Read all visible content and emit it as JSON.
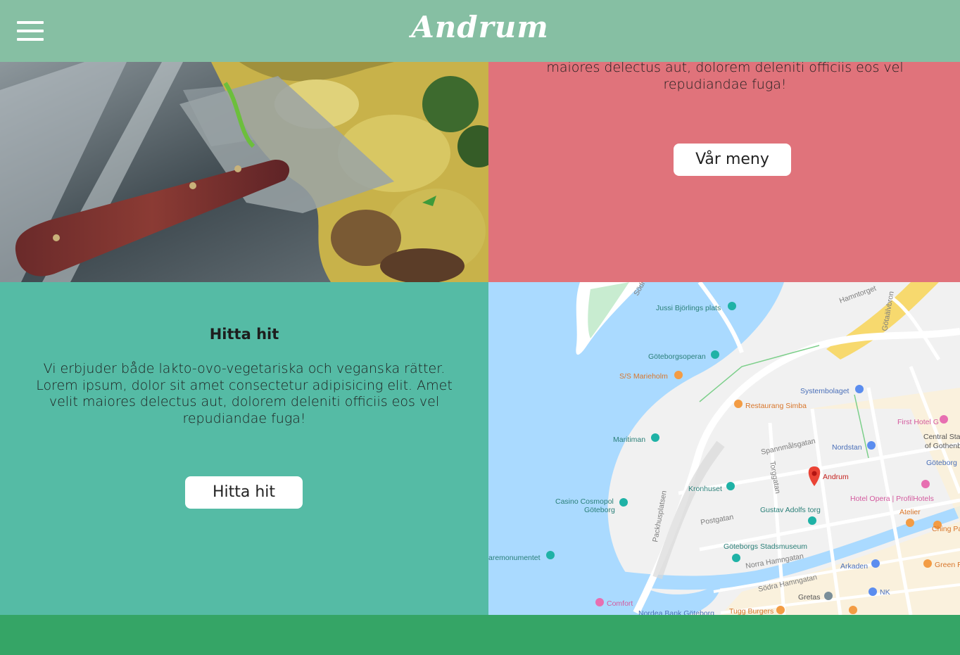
{
  "header": {
    "logo": "Andrum",
    "menu_icon": "hamburger-menu-icon"
  },
  "menu_section": {
    "text": "maiores delectus aut, dolorem deleniti officiis eos vel repudiandae fuga!",
    "button_label": "Vår meny"
  },
  "find_section": {
    "title": "Hitta hit",
    "text": "Vi erbjuder både lakto-ovo-vegetariska och veganska rätter. Lorem ipsum, dolor sit amet consectetur adipisicing elit. Amet velit maiores delectus aut, dolorem deleniti officiis eos vel repudiandae fuga!",
    "button_label": "Hitta hit"
  },
  "map": {
    "labels": {
      "jussi": "Jussi Björlings plats",
      "hamntorget": "Hamntorget",
      "gotaalvbron": "Götaälvbron",
      "opera": "Göteborgsoperan",
      "marieholm": "S/S Marieholm",
      "systembolaget": "Systembolaget",
      "simba": "Restaurang Simba",
      "firsthotel": "First Hotel G",
      "central": "Central Sta",
      "gothenburg": "of Gothenb",
      "nordstan": "Nordstan",
      "goteborg": "Göteborg",
      "maritiman": "Maritiman",
      "spannmal": "Spannmålsgatan",
      "torggatan": "Torggatan",
      "andrum": "Andrum",
      "kronhuset": "Kronhuset",
      "hotelopera": "Hotel Opera | ProfilHotels",
      "casino": "Casino Cosmopol",
      "casino2": "Göteborg",
      "gustav": "Gustav Adolfs torg",
      "atelier": "Atelier",
      "chingpa": "Ching Pa",
      "packhus": "Packhusplatsen",
      "postgatan": "Postgatan",
      "stadsmuseum": "Göteborgs Stadsmuseum",
      "monumentet": "aremonumentet",
      "norrahamn": "Norra Hamngatan",
      "arkaden": "Arkaden",
      "greenr": "Green R",
      "sodrahamn": "Södra Hamngatan",
      "nk": "NK",
      "gretas": "Gretas",
      "comfort": "Comfort",
      "nordea": "Nordea Bank Göteborg",
      "tugg": "Tugg Burgers",
      "sodra": "Södra"
    },
    "colors": {
      "water": "#aadaff",
      "land": "#f1f1f1",
      "park": "#c8ecd0",
      "shopping": "#fcf1d9",
      "road_yellow": "#f7d96e",
      "poi_teal": "#1fb2a6",
      "poi_orange": "#f39c44",
      "poi_blue": "#5b8def",
      "poi_pink": "#e76fb1",
      "marker_red": "#ea4335"
    }
  },
  "colors": {
    "header_bg": "#86bfa3",
    "menu_panel_bg": "#e0737b",
    "find_panel_bg": "#55bba5",
    "footer_bg": "#35a566"
  }
}
